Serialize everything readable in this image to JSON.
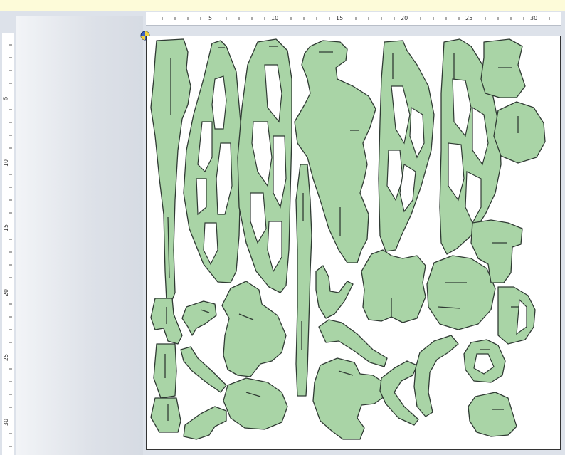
{
  "horizontal_ruler": {
    "labels": [
      "5",
      "10",
      "15",
      "20",
      "25",
      "30"
    ]
  },
  "vertical_ruler": {
    "labels": [
      "5",
      "10",
      "15",
      "20",
      "25",
      "30"
    ]
  },
  "colors": {
    "part_fill": "#a9d4a6",
    "part_stroke": "#2f3a33",
    "slot_stroke": "#2f3a33",
    "canvas": "#ffffff"
  },
  "icons": {
    "origin": "origin-marker-icon"
  }
}
